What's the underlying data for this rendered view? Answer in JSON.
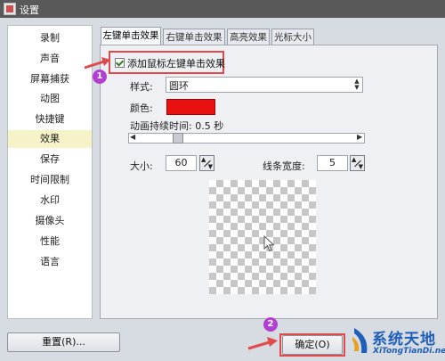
{
  "window": {
    "title": "设置"
  },
  "sidebar": {
    "items": [
      {
        "label": "录制"
      },
      {
        "label": "声音"
      },
      {
        "label": "屏幕捕获"
      },
      {
        "label": "动图"
      },
      {
        "label": "快捷键"
      },
      {
        "label": "效果"
      },
      {
        "label": "保存"
      },
      {
        "label": "时间限制"
      },
      {
        "label": "水印"
      },
      {
        "label": "摄像头"
      },
      {
        "label": "性能"
      },
      {
        "label": "语言"
      }
    ],
    "active_index": 5
  },
  "tabs": [
    {
      "label": "左键单击效果"
    },
    {
      "label": "右键单击效果"
    },
    {
      "label": "高亮效果"
    },
    {
      "label": "光标大小"
    }
  ],
  "panel": {
    "enable_label": "添加鼠标左键单击效果",
    "enable_checked": true,
    "style_label": "样式:",
    "style_value": "圆环",
    "color_label": "颜色:",
    "color_value": "#e81010",
    "duration_label": "动画持续时间: 0.5 秒",
    "size_label": "大小:",
    "size_value": "60",
    "width_label": "线条宽度:",
    "width_value": "5"
  },
  "footer": {
    "reset_label": "重置(R)...",
    "ok_label": "确定(O)"
  },
  "annotations": {
    "badge1": "1",
    "badge2": "2"
  },
  "watermark": {
    "title": "系统天地",
    "url": "XiTongTianDi.net"
  },
  "colors": {
    "accent_highlight": "#e04a4a",
    "badge": "#b23fd1",
    "selected_nav": "#f6f3c8"
  }
}
